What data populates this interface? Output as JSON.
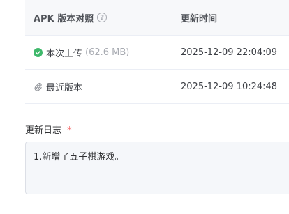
{
  "table": {
    "headers": {
      "version": "APK 版本对照",
      "time": "更新时间"
    },
    "rows": [
      {
        "label": "本次上传",
        "size": "(62.6 MB)",
        "time": "2025-12-09 22:04:09",
        "icon": "check-circle-icon"
      },
      {
        "label": "最近版本",
        "time": "2025-12-09 10:24:48",
        "icon": "paperclip-icon"
      }
    ]
  },
  "changelog": {
    "label": "更新日志",
    "required_mark": "*",
    "value": "1.新增了五子棋游戏。"
  },
  "colors": {
    "success": "#3fb86b",
    "required": "#f56c6c"
  }
}
